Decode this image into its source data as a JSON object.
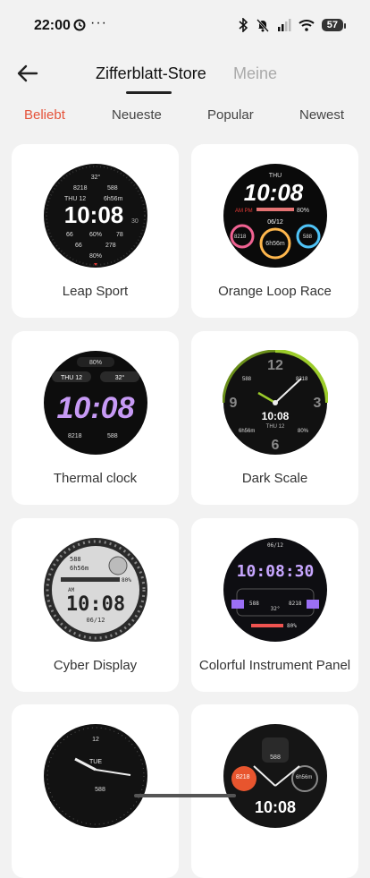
{
  "status_bar": {
    "time": "22:00",
    "overflow": "···",
    "battery": "57"
  },
  "header": {
    "tabs": [
      {
        "label": "Zifferblatt-Store",
        "active": true
      },
      {
        "label": "Meine",
        "active": false
      }
    ]
  },
  "filters": [
    {
      "label": "Beliebt",
      "selected": true
    },
    {
      "label": "Neueste",
      "selected": false
    },
    {
      "label": "Popular",
      "selected": false
    },
    {
      "label": "Newest",
      "selected": false
    }
  ],
  "accent_color": "#e5533a",
  "watchfaces": [
    {
      "name": "Leap Sport",
      "face": {
        "temp": "32°",
        "top_left": "8218",
        "top_right": "588",
        "day": "THU 12",
        "duration": "6h56m",
        "time": "10:08",
        "seconds": "30",
        "b1": "66",
        "b2": "60%",
        "b3": "78",
        "b4": "66",
        "b5": "278",
        "battery": "80%"
      }
    },
    {
      "name": "Orange Loop Race",
      "face": {
        "day": "THU",
        "time": "10:08",
        "ampm": "AM PM",
        "battery": "80%",
        "date": "06/12",
        "left": "8218",
        "right": "588",
        "duration": "6h56m"
      }
    },
    {
      "name": "Thermal clock",
      "face": {
        "battery": "80%",
        "day": "THU 12",
        "temp": "32°",
        "time": "10:08",
        "steps": "8218",
        "cal": "588"
      }
    },
    {
      "name": "Dark Scale",
      "face": {
        "n12": "12",
        "n3": "3",
        "n6": "6",
        "n9": "9",
        "tl": "588",
        "tr": "8218",
        "time": "10:08",
        "date": "THU 12",
        "bl": "6h56m",
        "br": "80%"
      }
    },
    {
      "name": "Cyber Display",
      "face": {
        "cal": "588",
        "duration": "6h56m",
        "battery": "80%",
        "ampm": "AM",
        "time": "10:08",
        "date": "06/12"
      }
    },
    {
      "name": "Colorful Instrument Panel",
      "face": {
        "date": "06/12",
        "time": "10:08:30",
        "left": "588",
        "temp": "32°",
        "right": "8218",
        "battery": "80%"
      }
    },
    {
      "name": "",
      "face": {
        "n12": "12",
        "day": "TUE",
        "steps": "588"
      }
    },
    {
      "name": "",
      "face": {
        "cal": "588",
        "left": "8218",
        "right": "6h56m",
        "time": "10:08"
      }
    }
  ]
}
